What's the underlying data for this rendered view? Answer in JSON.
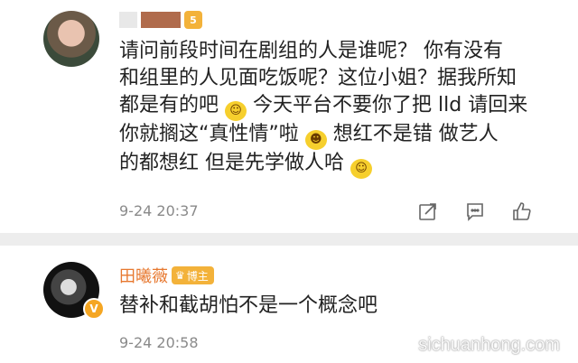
{
  "comments": [
    {
      "level_badge": "5",
      "lines": [
        "请问前段时间在剧组的人是谁呢？ 你有没有",
        "和组里的人见面吃饭呢？这位小姐？据我所知",
        "都是有的吧",
        "今天平台不要你了把 lld 请回来",
        "你就搁这“真性情”啦",
        "想红不是错 做艺人",
        "的都想红 但是先学做人哈"
      ],
      "time": "9-24 20:37"
    },
    {
      "name": "田曦薇",
      "badge": "博主",
      "text": "替补和截胡怕不是一个概念吧",
      "time": "9-24 20:58"
    }
  ],
  "watermark": "sichuanhong.com"
}
